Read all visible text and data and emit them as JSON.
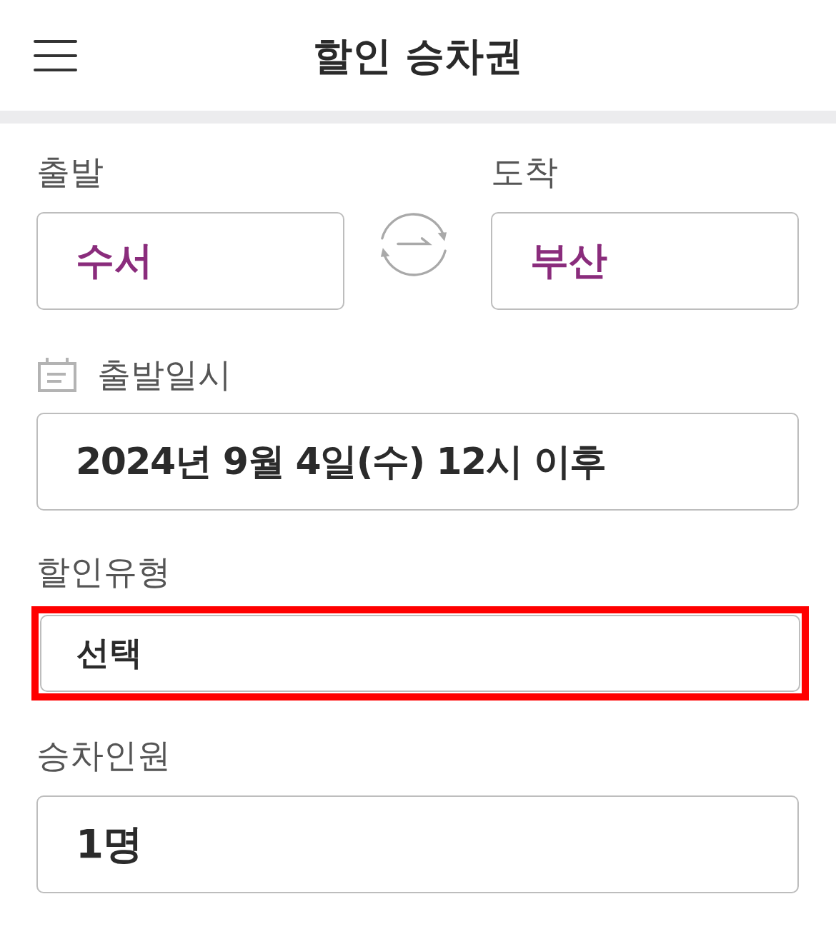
{
  "header": {
    "title": "할인 승차권"
  },
  "route": {
    "departure": {
      "label": "출발",
      "value": "수서"
    },
    "arrival": {
      "label": "도착",
      "value": "부산"
    }
  },
  "fields": [
    {
      "kind": "date",
      "label": "출발일시",
      "value": "2024년 9월 4일(수) 12시 이후",
      "highlighted": false
    },
    {
      "kind": "select",
      "label": "할인유형",
      "value": "선택",
      "highlighted": true
    },
    {
      "kind": "count",
      "label": "승차인원",
      "value": "1명",
      "highlighted": false
    }
  ]
}
